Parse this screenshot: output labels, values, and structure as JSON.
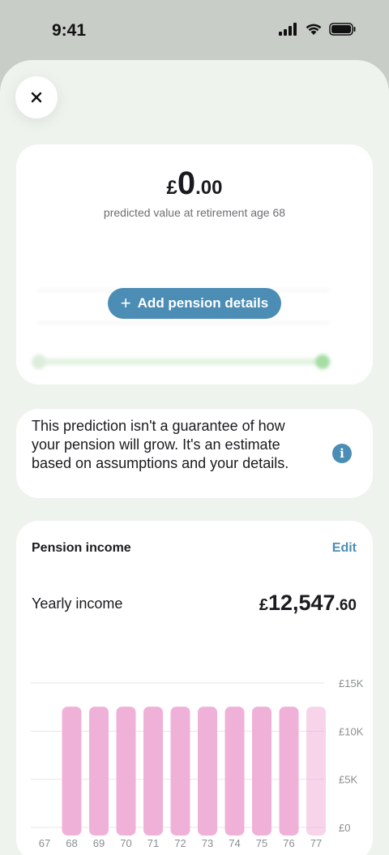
{
  "status_bar": {
    "time": "9:41"
  },
  "close": {
    "icon": "close-icon",
    "symbol": "✕"
  },
  "prediction": {
    "currency": "£",
    "whole": "0",
    "decimal": ".00",
    "caption": "predicted value at retirement age 68",
    "add_button_label": "Add pension details"
  },
  "disclaimer": {
    "text": "This prediction isn't a guarantee of how your pension will grow. It's an estimate based on assumptions and your details.",
    "info_icon": "i"
  },
  "income": {
    "title": "Pension income",
    "edit_label": "Edit",
    "yearly_label": "Yearly income",
    "currency": "£",
    "yearly_whole": "12,547",
    "yearly_decimal": ".60"
  },
  "colors": {
    "accent": "#4b8db4",
    "bar": "#f0b1d9",
    "sheet": "#eef3ee",
    "status_bg": "#c9cdc8"
  },
  "chart_data": {
    "type": "bar",
    "categories": [
      "67",
      "68",
      "69",
      "70",
      "71",
      "72",
      "73",
      "74",
      "75",
      "76",
      "77"
    ],
    "values": [
      0,
      12547.6,
      12547.6,
      12547.6,
      12547.6,
      12547.6,
      12547.6,
      12547.6,
      12547.6,
      12547.6,
      12547.6
    ],
    "ytick_labels": [
      "£15K",
      "£10K",
      "£5K",
      "£0"
    ],
    "ytick_values": [
      15000,
      10000,
      5000,
      0
    ],
    "ylim": [
      0,
      15000
    ],
    "grid": true,
    "title": "",
    "xlabel": "",
    "ylabel": ""
  }
}
